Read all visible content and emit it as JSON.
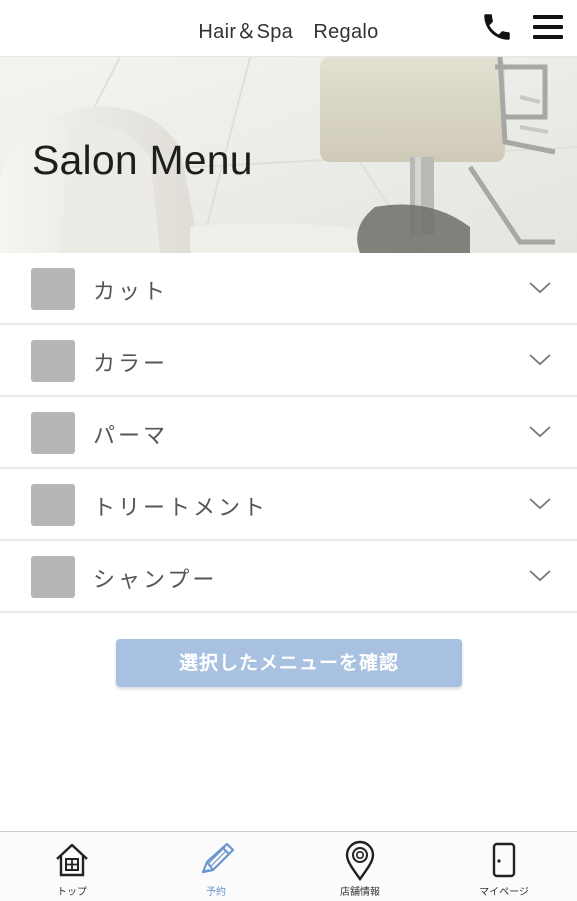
{
  "header": {
    "title": "Hair＆Spa　Regalo",
    "phone_icon": "phone-icon",
    "menu_icon": "hamburger-menu-icon"
  },
  "hero": {
    "title": "Salon Menu"
  },
  "menu": {
    "items": [
      {
        "label": "カット",
        "selected": false
      },
      {
        "label": "カラー",
        "selected": false
      },
      {
        "label": "パーマ",
        "selected": false
      },
      {
        "label": "トリートメント",
        "selected": false
      },
      {
        "label": "シャンプー",
        "selected": false
      }
    ],
    "expand_icon": "chevron-down-icon"
  },
  "confirm_button": {
    "label": "選択したメニューを確認",
    "color": "#a9c1e1"
  },
  "tab_bar": {
    "items": [
      {
        "label": "トップ",
        "icon": "home-icon",
        "active": false
      },
      {
        "label": "予約",
        "icon": "pencil-icon",
        "active": true
      },
      {
        "label": "店舗情報",
        "icon": "map-pin-icon",
        "active": false
      },
      {
        "label": "マイページ",
        "icon": "door-icon",
        "active": false
      }
    ],
    "active_color": "#6a95cd"
  }
}
